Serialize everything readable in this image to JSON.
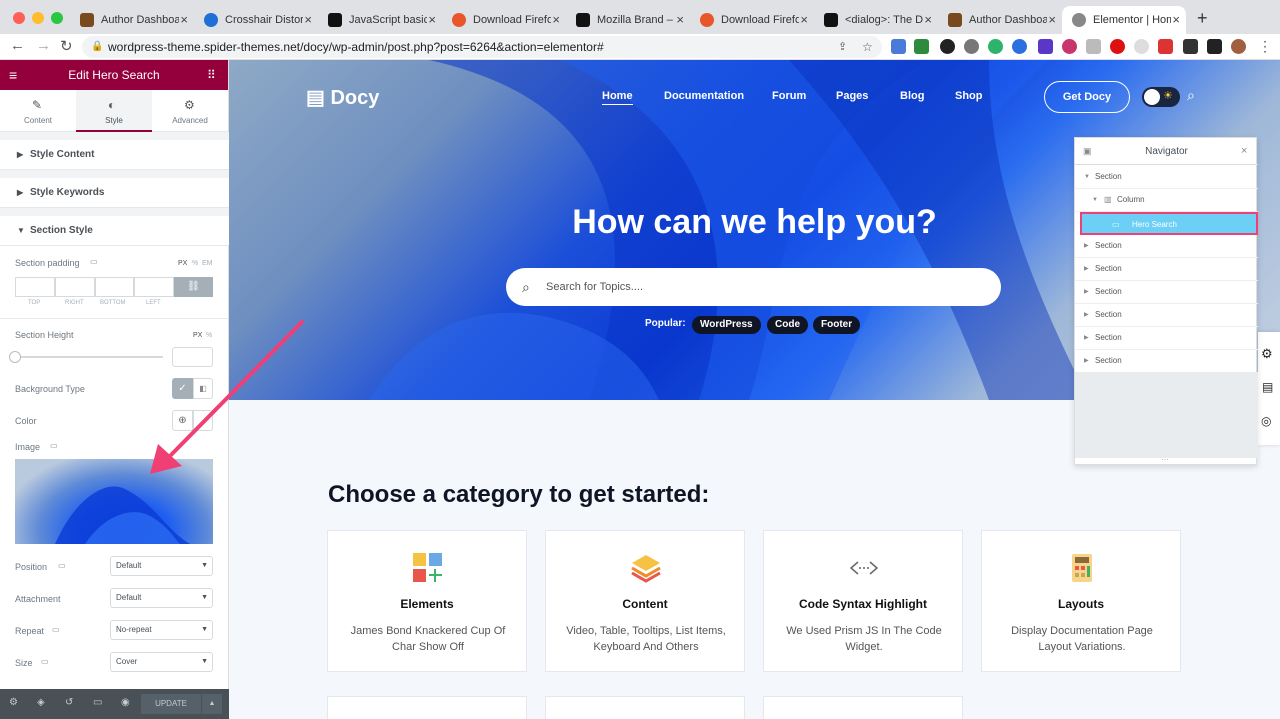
{
  "browser": {
    "tabs": [
      {
        "label": "Author Dashboard",
        "color": "#7a4a1f"
      },
      {
        "label": "Crosshair Distortion",
        "color": "#1f6fd6"
      },
      {
        "label": "JavaScript basics",
        "color": "#111111"
      },
      {
        "label": "Download Firefox",
        "color": "#e8572a"
      },
      {
        "label": "Mozilla Brand – M",
        "color": "#111111"
      },
      {
        "label": "Download Firefox",
        "color": "#e8572a"
      },
      {
        "label": "<dialog>: The Di",
        "color": "#111111"
      },
      {
        "label": "Author Dashboard",
        "color": "#7a4a1f"
      },
      {
        "label": "Elementor | Home",
        "color": "#555555"
      }
    ],
    "url": "wordpress-theme.spider-themes.net/docy/wp-admin/post.php?post=6264&action=elementor#",
    "new_tab": "+"
  },
  "sidebar": {
    "title": "Edit Hero Search",
    "tabs": [
      {
        "label": "Content",
        "icon": "pencil-icon"
      },
      {
        "label": "Style",
        "icon": "contrast-icon"
      },
      {
        "label": "Advanced",
        "icon": "gear-icon"
      }
    ],
    "sections": {
      "style_content": "Style Content",
      "style_keywords": "Style Keywords",
      "section_style": "Section Style"
    },
    "padding_label": "Section padding",
    "units": {
      "px": "PX",
      "pct": "%",
      "em": "EM"
    },
    "dim_labels": [
      "TOP",
      "RIGHT",
      "BOTTOM",
      "LEFT"
    ],
    "height_label": "Section Height",
    "bg_type_label": "Background Type",
    "color_label": "Color",
    "image_label": "Image",
    "position": {
      "label": "Position",
      "value": "Default"
    },
    "attachment": {
      "label": "Attachment",
      "value": "Default"
    },
    "repeat": {
      "label": "Repeat",
      "value": "No-repeat"
    },
    "size": {
      "label": "Size",
      "value": "Cover"
    },
    "update_label": "UPDATE"
  },
  "site": {
    "logo": "Docy",
    "nav": [
      "Home",
      "Documentation",
      "Forum",
      "Pages",
      "Blog",
      "Shop"
    ],
    "cta": "Get Docy",
    "hero_title": "How can we help you?",
    "search_placeholder": "Search for Topics....",
    "popular_label": "Popular:",
    "popular_tags": [
      "WordPress",
      "Code",
      "Footer"
    ],
    "category_heading": "Choose a category to get started:",
    "cards": [
      {
        "title": "Elements",
        "desc": "James Bond Knackered Cup Of Char Show Off",
        "icon": "grid-plus-icon"
      },
      {
        "title": "Content",
        "desc": "Video, Table, Tooltips, List Items, Keyboard And Others",
        "icon": "layers-icon"
      },
      {
        "title": "Code Syntax Highlight",
        "desc": "We Used Prism JS In The Code Widget.",
        "icon": "code-icon"
      },
      {
        "title": "Layouts",
        "desc": "Display Documentation Page Layout Variations.",
        "icon": "calculator-icon"
      }
    ]
  },
  "navigator": {
    "title": "Navigator",
    "rows": [
      {
        "label": "Section",
        "level": 0
      },
      {
        "label": "Column",
        "level": 1
      },
      {
        "label": "Hero Search",
        "level": 2,
        "selected": true
      },
      {
        "label": "Section",
        "level": 0
      },
      {
        "label": "Section",
        "level": 0
      },
      {
        "label": "Section",
        "level": 0
      },
      {
        "label": "Section",
        "level": 0
      },
      {
        "label": "Section",
        "level": 0
      },
      {
        "label": "Section",
        "level": 0
      }
    ]
  },
  "colors": {
    "elementor": "#93003c",
    "annotation": "#ef3f74",
    "selected_row": "#6ccff6"
  }
}
